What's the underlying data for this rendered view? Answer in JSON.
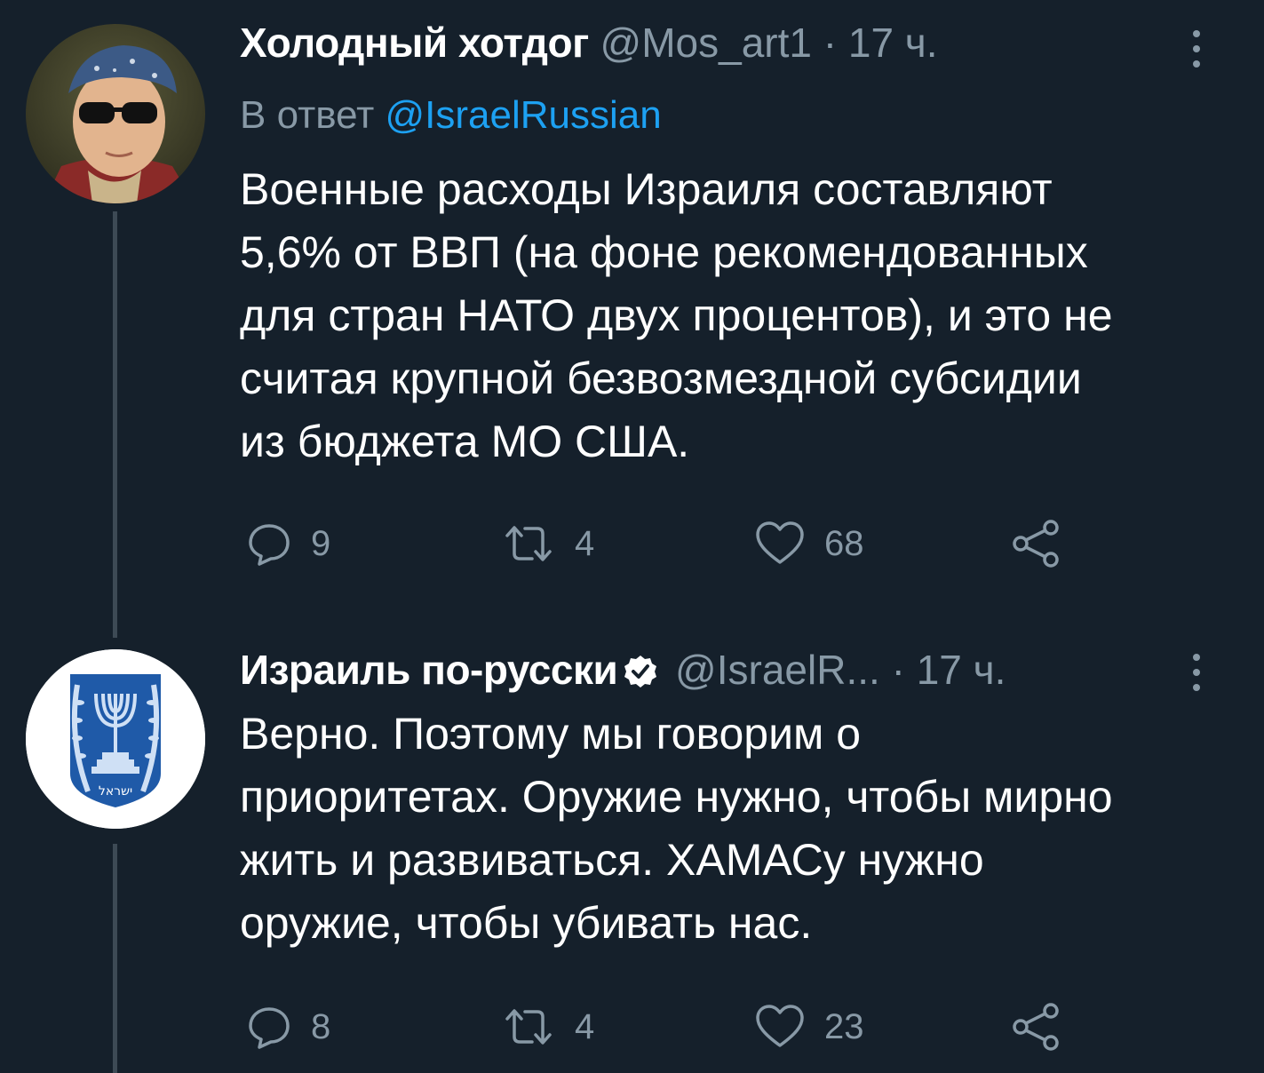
{
  "tweets": [
    {
      "author_name": "Холодный хотдог",
      "handle": "@Mos_art1",
      "separator": "·",
      "time": "17 ч.",
      "reply_prefix": "В ответ",
      "reply_mention": "@IsraelRussian",
      "text_lines": [
        "Военные расходы Израиля составляют",
        "5,6% от ВВП (на фоне рекомендованных",
        "для стран НАТО двух процентов), и это не",
        "считая крупной безвозмездной субсидии",
        "из бюджета МО США."
      ],
      "replies": "9",
      "retweets": "4",
      "likes": "68"
    },
    {
      "author_name": "Израиль по-русски",
      "verified": true,
      "handle": "@IsraelR...",
      "separator": "·",
      "time": "17 ч.",
      "text_lines": [
        "Верно. Поэтому мы говорим о",
        "приоритетах. Оружие нужно, чтобы мирно",
        "жить и развиваться. ХАМАСу нужно",
        "оружие, чтобы убивать нас."
      ],
      "replies": "8",
      "retweets": "4",
      "likes": "23"
    }
  ],
  "icons": {
    "reply": "reply-icon",
    "retweet": "retweet-icon",
    "like": "heart-icon",
    "share": "share-icon",
    "more": "more-vertical-icon",
    "verified": "verified-badge-icon"
  },
  "colors": {
    "background": "#15202b",
    "secondary_text": "#8899a6",
    "link": "#1da1f2",
    "thread_line": "#3d4a55"
  },
  "emblem_text": "ישראל"
}
